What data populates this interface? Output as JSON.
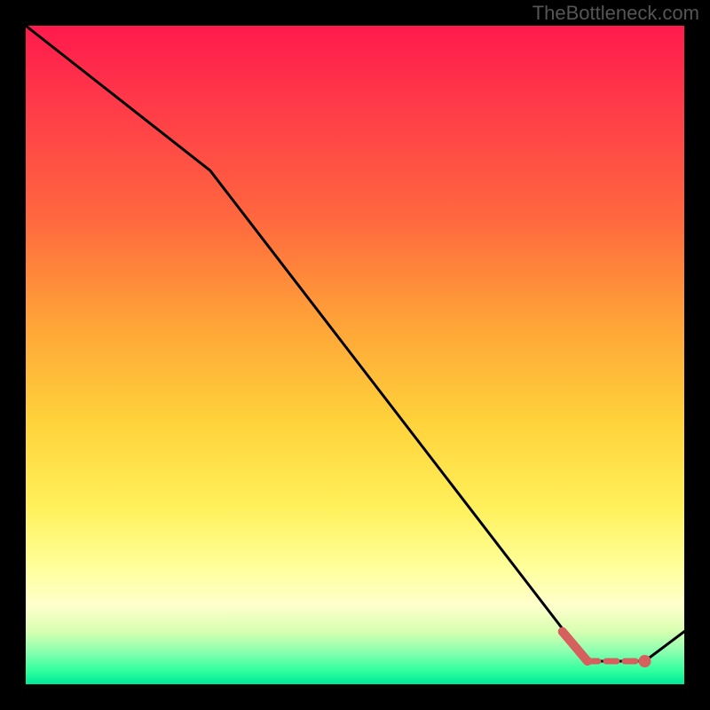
{
  "watermark": "TheBottleneck.com",
  "chart_data": {
    "type": "line",
    "title": "",
    "xlabel": "",
    "ylabel": "",
    "xlim": [
      0,
      100
    ],
    "ylim": [
      0,
      100
    ],
    "grid": false,
    "legend": false,
    "series": [
      {
        "name": "bottleneck-curve",
        "color": "#000000",
        "x": [
          0,
          28,
          85.3,
          94,
          100
        ],
        "y": [
          100,
          78,
          3.5,
          3.5,
          8
        ],
        "note": "Piecewise curve: the black line descends from top-left with a slope change near x≈28, reaches a flat minimum over x≈85–94 at y≈3.5, then rises slightly toward x=100."
      }
    ],
    "highlight_region": {
      "color": "#d5605e",
      "description": "Salmon overlay marking the minimum-bottleneck zone near the bottom-right. Short solid descending segment, a dashed flat span, and a small filled dot at x≈94.",
      "solid_segment": {
        "x": [
          81.5,
          85.3
        ],
        "y": [
          8,
          3.5
        ]
      },
      "dashed_segment": {
        "x": [
          85.3,
          94
        ],
        "y": [
          3.5,
          3.5
        ]
      },
      "dot": {
        "x": 94,
        "y": 3.5
      }
    },
    "background": {
      "type": "vertical-gradient",
      "stops": [
        {
          "pos": 0,
          "color": "#ff1a4d"
        },
        {
          "pos": 45,
          "color": "#ffa338"
        },
        {
          "pos": 73,
          "color": "#fff05a"
        },
        {
          "pos": 88,
          "color": "#ffffcc"
        },
        {
          "pos": 100,
          "color": "#00e89a"
        }
      ]
    }
  }
}
